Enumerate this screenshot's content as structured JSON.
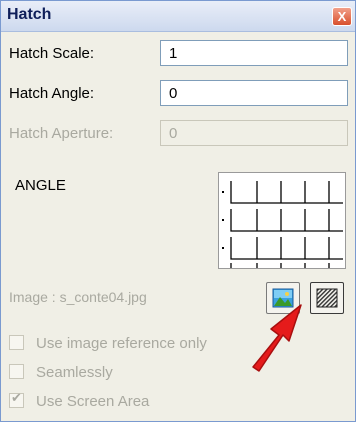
{
  "window": {
    "title": "Hatch",
    "close_glyph": "X"
  },
  "fields": {
    "hatch_scale_label": "Hatch Scale:",
    "hatch_scale_value": "1",
    "hatch_angle_label": "Hatch Angle:",
    "hatch_angle_value": "0",
    "hatch_aperture_label": "Hatch Aperture:",
    "hatch_aperture_value": "0"
  },
  "pattern": {
    "name": "ANGLE"
  },
  "image": {
    "label": "Image :  s_conte04.jpg"
  },
  "options": {
    "use_image_reference_only": "Use image reference only",
    "seamlessly": "Seamlessly",
    "use_screen_area": "Use Screen Area",
    "use_screen_area_checked": true
  },
  "icons": {
    "close": "close-icon",
    "image_picker": "landscape-image-icon",
    "hatch_picker": "hatch-pattern-icon",
    "annotation": "red-arrow-annotation-icon"
  },
  "colors": {
    "title_text": "#0f1f5a",
    "close_button": "#d8502d",
    "arrow": "#e51b1b"
  }
}
